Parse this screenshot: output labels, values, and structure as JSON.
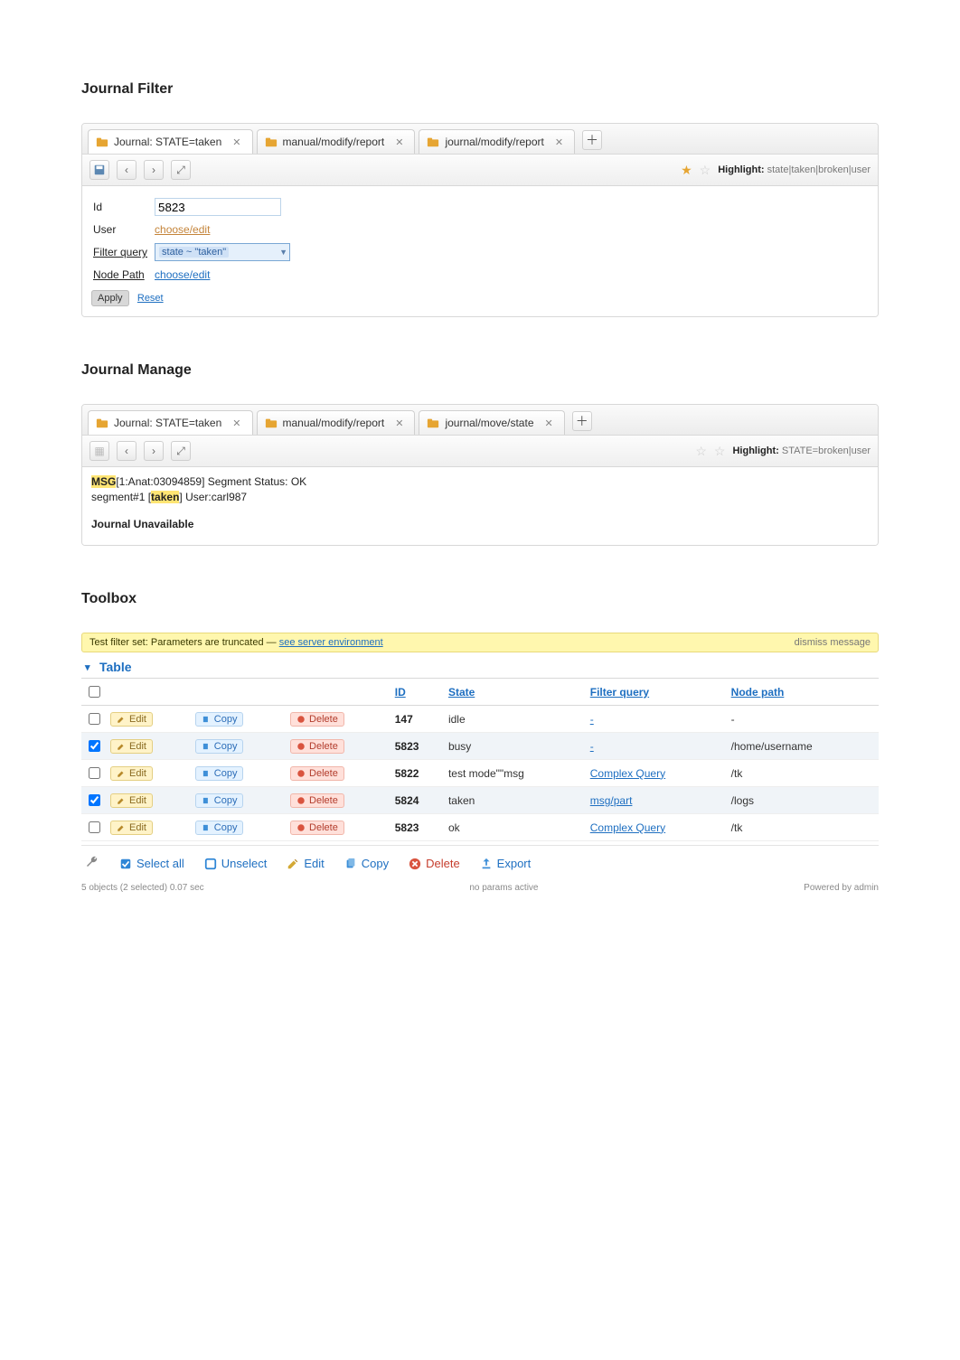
{
  "sections": {
    "filter_title": "Journal Filter",
    "manage_title": "Journal Manage",
    "toolbox_title": "Toolbox"
  },
  "filter": {
    "tabs": [
      {
        "label": "Journal: STATE=taken"
      },
      {
        "label": "manual/modify/report"
      },
      {
        "label": "journal/modify/report"
      }
    ],
    "highlight_label": "Highlight:",
    "highlight_value": "state|taken|broken|user",
    "form": {
      "id_label": "Id",
      "id_value": "5823",
      "user_label": "User",
      "user_link": "choose/edit",
      "filter_query_label": "Filter query",
      "filter_query_value": "state ~ \"taken\"",
      "node_path_label": "Node Path",
      "node_path_link": "choose/edit"
    },
    "apply_label": "Apply",
    "reset_label": "Reset"
  },
  "manage": {
    "tabs": [
      {
        "label": "Journal: STATE=taken"
      },
      {
        "label": "manual/modify/report"
      },
      {
        "label": "journal/move/state"
      }
    ],
    "highlight_label": "Highlight:",
    "highlight_value": "STATE=broken|user",
    "line1_hl": "MSG",
    "line1_rest": "[1:Anat:03094859] Segment Status: OK",
    "line2_a": "segment#1 [",
    "line2_hl": "taken",
    "line2_rest": "] User:carl987",
    "unavailable": "Journal Unavailable"
  },
  "toolbox": {
    "banner": "Test filter set: Parameters are truncated",
    "banner_link": "see server environment",
    "banner_action": "dismiss message",
    "tree_label": "Table",
    "columns": [
      "",
      "",
      "",
      "",
      "ID",
      "State",
      "Filter query",
      "Node path"
    ],
    "rows": [
      {
        "id": "147",
        "state": "idle",
        "query": "-",
        "path": "-",
        "actions": [
          "Edit",
          "Copy",
          "Delete"
        ]
      },
      {
        "id": "5823",
        "state": "busy",
        "query": "-",
        "path": "/home/username",
        "actions": [
          "Edit",
          "Copy",
          "Delete"
        ]
      },
      {
        "id": "5822",
        "state": "test mode\"\"msg",
        "query": "Complex Query",
        "path": "/tk",
        "actions": [
          "Edit",
          "Copy",
          "Delete"
        ]
      },
      {
        "id": "5824",
        "state": "taken",
        "query": "msg/part",
        "path": "/logs",
        "actions": [
          "Edit",
          "Copy",
          "Delete"
        ]
      },
      {
        "id": "5823",
        "state": "ok",
        "query": "Complex Query",
        "path": "/tk",
        "actions": [
          "Edit",
          "Copy",
          "Delete"
        ]
      }
    ],
    "actions": {
      "select_all": "Select all",
      "unselect": "Unselect",
      "edit": "Edit",
      "copy": "Copy",
      "delete": "Delete",
      "export": "Export"
    },
    "footer_left": "5 objects (2 selected) 0.07 sec",
    "footer_mid": "no params active",
    "footer_right": "Powered by admin"
  }
}
